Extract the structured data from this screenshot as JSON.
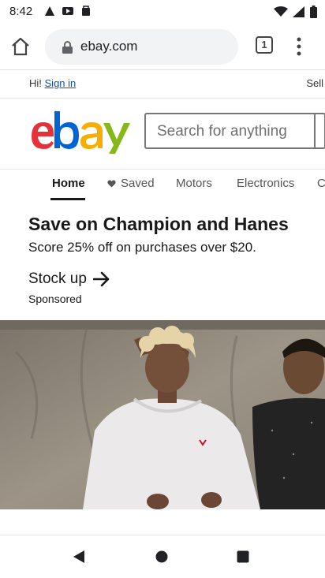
{
  "status_bar": {
    "time": "8:42"
  },
  "browser": {
    "url": "ebay.com",
    "tab_count": "1"
  },
  "header": {
    "greeting": "Hi!",
    "sign_in": "Sign in",
    "sell": "Sell",
    "search_placeholder": "Search for anything"
  },
  "nav": {
    "items": [
      {
        "label": "Home"
      },
      {
        "label": "Saved"
      },
      {
        "label": "Motors"
      },
      {
        "label": "Electronics"
      },
      {
        "label": "C"
      }
    ]
  },
  "promo": {
    "title": "Save on Champion and Hanes",
    "subtitle": "Score 25% off on purchases over $20.",
    "cta": "Stock up",
    "sponsored": "Sponsored"
  },
  "colors": {
    "ebay_red": "#e53238",
    "ebay_blue": "#0064d2",
    "ebay_yellow": "#f5af02",
    "ebay_green": "#86b817",
    "link_blue": "#0654ba"
  }
}
